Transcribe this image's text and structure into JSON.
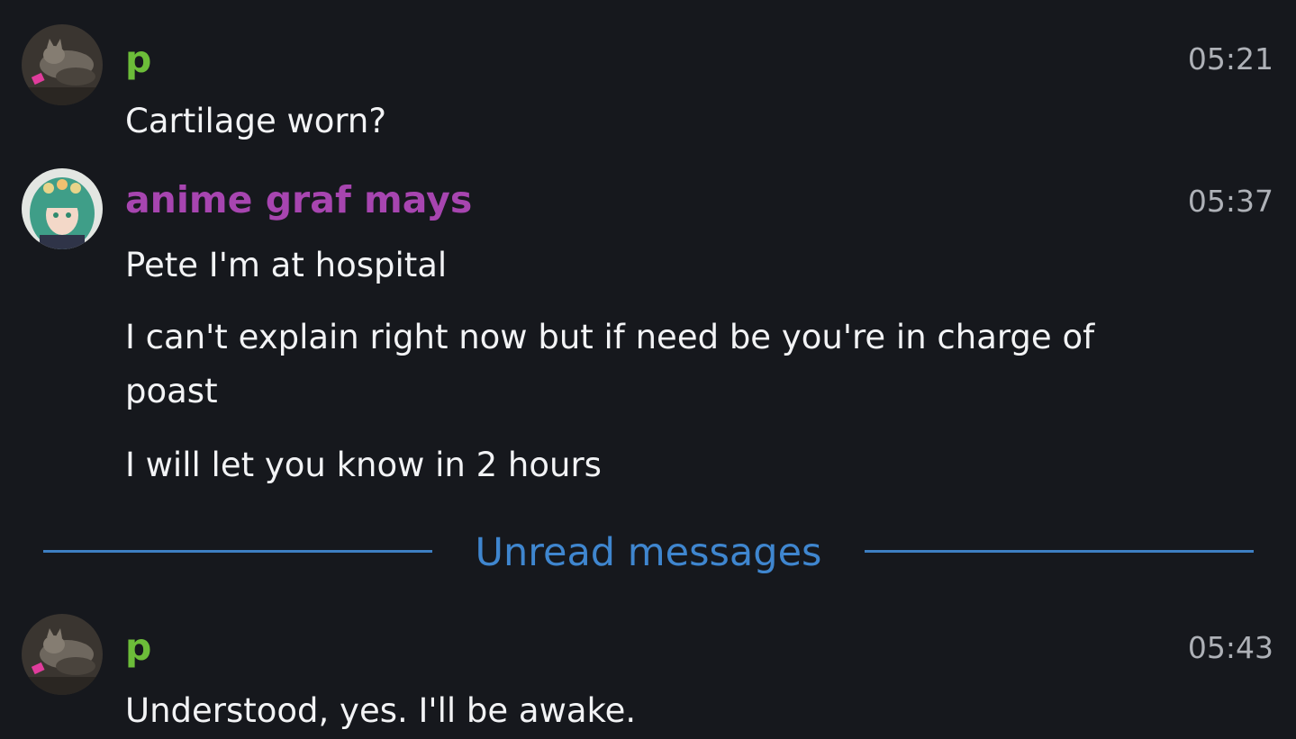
{
  "colors": {
    "background": "#16181d",
    "author_p": "#6cbd39",
    "author_mays": "#a745b0",
    "divider": "#3d7fc2",
    "timestamp": "#aeb1b7"
  },
  "messages": [
    {
      "author": "p",
      "time": "05:21",
      "lines": [
        "Cartilage worn?"
      ]
    },
    {
      "author": "anime graf mays",
      "time": "05:37",
      "lines": [
        "Pete I'm at hospital",
        "I can't explain right now but if need be you're in charge of",
        "poast",
        "I will let you know in 2 hours"
      ]
    },
    {
      "author": "p",
      "time": "05:43",
      "lines": [
        "Understood, yes.  I'll be awake."
      ]
    }
  ],
  "divider": {
    "label": "Unread messages"
  }
}
